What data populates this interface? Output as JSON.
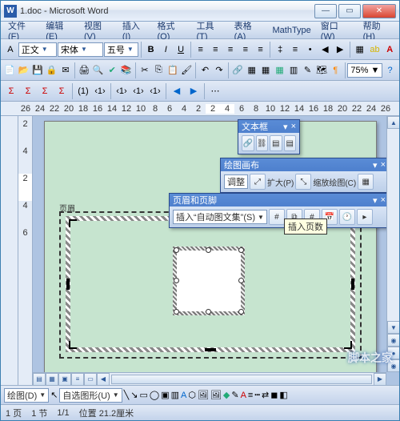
{
  "title": "1.doc - Microsoft Word",
  "menus": {
    "file": "文件(F)",
    "edit": "编辑(E)",
    "view": "视图(V)",
    "insert": "插入(I)",
    "format": "格式(O)",
    "tools": "工具(T)",
    "table": "表格(A)",
    "mathtype": "MathType",
    "window": "窗口(W)",
    "help": "帮助(H)"
  },
  "formatting": {
    "style": "正文",
    "font": "宋体",
    "size": "五号",
    "zoom": "75%"
  },
  "ruler_top": [
    "26",
    "24",
    "22",
    "20",
    "18",
    "16",
    "14",
    "12",
    "10",
    "8",
    "6",
    "4",
    "2",
    "",
    "2",
    "4",
    "",
    "6",
    "8",
    "10",
    "12",
    "14",
    "16",
    "18",
    "20",
    "22",
    "24",
    "26"
  ],
  "ruler_left": [
    "",
    "2",
    "4",
    "",
    "2",
    "4",
    "6"
  ],
  "float": {
    "textbox": {
      "title": "文本框"
    },
    "canvas": {
      "title": "绘图画布",
      "fit": "调整",
      "expand": "扩大(P)",
      "scale": "缩放绘图(C)"
    },
    "hf": {
      "title": "页眉和页脚",
      "insert_autotext": "插入“自动图文集”(S)"
    }
  },
  "hf_label": "页眉",
  "tooltip": "插入页数",
  "status": {
    "page": "1 页",
    "sec": "1 节",
    "pages": "1/1",
    "pos": "位置 21.2厘米"
  },
  "drawbar": {
    "draw": "绘图(D)",
    "autoshapes": "自选图形(U)"
  },
  "icons": {
    "new": "📄",
    "open": "📂",
    "save": "💾",
    "print": "🖨",
    "preview": "🔍",
    "spell": "✔",
    "cut": "✂",
    "copy": "📋",
    "paste": "📋",
    "undo": "↶",
    "redo": "↷",
    "link": "🔗",
    "table": "▦",
    "excel": "▦",
    "cols": "≡",
    "draw": "✎",
    "chart": "📊",
    "map": "🗺",
    "para": "¶",
    "bold": "B",
    "italic": "I",
    "underline": "U",
    "left": "≡",
    "center": "≡",
    "right": "≡",
    "justify": "≡",
    "numlist": "≡",
    "bullist": "•",
    "outdent": "◀",
    "indent": "▶",
    "border": "▦",
    "highlight": "🖍",
    "fontcolor": "A",
    "sigma": "Σ"
  },
  "watermark": "脚本之家"
}
